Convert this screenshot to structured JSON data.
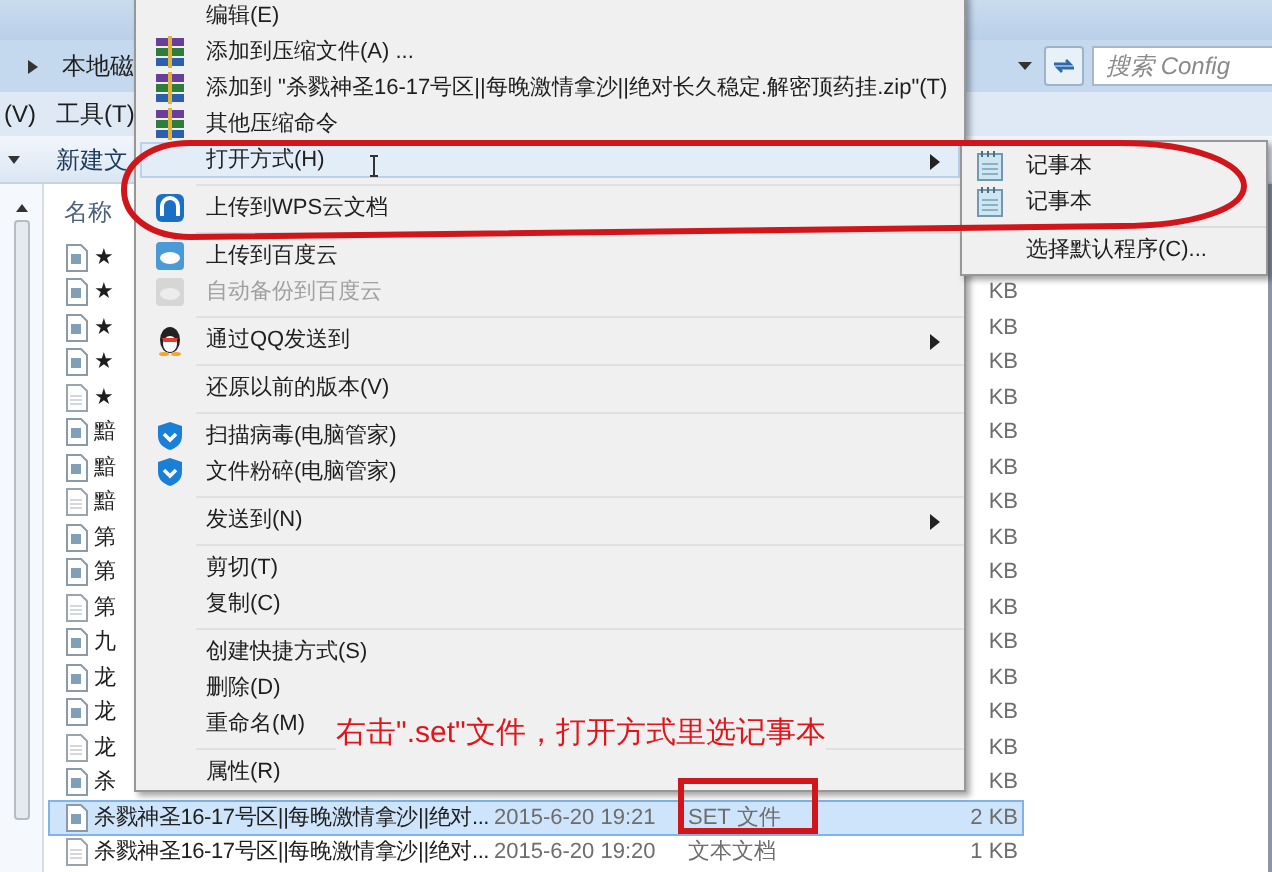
{
  "address_bar": {
    "path": "本地磁"
  },
  "search": {
    "placeholder": "搜索 Config"
  },
  "menu_bar": [
    "(V)",
    "工具(T)"
  ],
  "command_bar": [
    "新建文"
  ],
  "columns": [
    "名称"
  ],
  "files": [
    {
      "name": "★",
      "kind": "set",
      "selected": false
    },
    {
      "name": "★",
      "kind": "set",
      "size": "KB",
      "selected": false
    },
    {
      "name": "★",
      "kind": "set",
      "size": "KB",
      "selected": false
    },
    {
      "name": "★",
      "kind": "set",
      "size": "KB",
      "selected": false
    },
    {
      "name": "★",
      "kind": "text",
      "size": "KB",
      "selected": false
    },
    {
      "name": "黯",
      "kind": "set",
      "size": "KB",
      "selected": false
    },
    {
      "name": "黯",
      "kind": "set",
      "size": "KB",
      "selected": false
    },
    {
      "name": "黯",
      "kind": "text",
      "size": "KB",
      "selected": false
    },
    {
      "name": "第",
      "kind": "set",
      "size": "KB",
      "selected": false
    },
    {
      "name": "第",
      "kind": "set",
      "size": "KB",
      "selected": false
    },
    {
      "name": "第",
      "kind": "text",
      "size": "KB",
      "selected": false
    },
    {
      "name": "九",
      "kind": "set",
      "size": "KB",
      "selected": false
    },
    {
      "name": "龙",
      "kind": "set",
      "size": "KB",
      "selected": false
    },
    {
      "name": "龙",
      "kind": "set",
      "size": "KB",
      "selected": false
    },
    {
      "name": "龙",
      "kind": "text",
      "size": "KB",
      "selected": false
    },
    {
      "name": "杀",
      "kind": "set",
      "size": "KB",
      "selected": false
    },
    {
      "name": "杀戮神圣16-17号区||每晚激情拿沙||绝对...",
      "kind": "set",
      "date": "2015-6-20 19:21",
      "type": "SET 文件",
      "size": "2 KB",
      "selected": true
    },
    {
      "name": "杀戮神圣16-17号区||每晚激情拿沙||绝对...",
      "kind": "text",
      "date": "2015-6-20 19:20",
      "type": "文本文档",
      "size": "1 KB",
      "selected": false
    }
  ],
  "context_menu": {
    "groups": [
      [
        {
          "label": "编辑(E)",
          "kind": "plain",
          "selected": false,
          "disabled": false,
          "has_submenu": false
        },
        {
          "label": "添加到压缩文件(A) ...",
          "kind": "archive",
          "selected": false,
          "disabled": false,
          "has_submenu": false
        },
        {
          "label": "添加到 \"杀戮神圣16-17号区||每晚激情拿沙||绝对长久稳定.解密顶药挂.zip\"(T)",
          "kind": "archive",
          "selected": false,
          "disabled": false,
          "has_submenu": false
        },
        {
          "label": "其他压缩命令",
          "kind": "archive",
          "selected": false,
          "disabled": false,
          "has_submenu": false
        },
        {
          "label": "打开方式(H)",
          "kind": "plain",
          "selected": true,
          "disabled": false,
          "has_submenu": true
        }
      ],
      [
        {
          "label": "上传到WPS云文档",
          "kind": "wps",
          "selected": false,
          "disabled": false,
          "has_submenu": false
        }
      ],
      [
        {
          "label": "上传到百度云",
          "kind": "cloud",
          "selected": false,
          "disabled": false,
          "has_submenu": false
        },
        {
          "label": "自动备份到百度云",
          "kind": "cloud",
          "selected": false,
          "disabled": true,
          "has_submenu": false
        }
      ],
      [
        {
          "label": "通过QQ发送到",
          "kind": "penguin",
          "selected": false,
          "disabled": false,
          "has_submenu": true
        }
      ],
      [
        {
          "label": "还原以前的版本(V)",
          "kind": "plain",
          "selected": false,
          "disabled": false,
          "has_submenu": false
        }
      ],
      [
        {
          "label": "扫描病毒(电脑管家)",
          "kind": "shield",
          "selected": false,
          "disabled": false,
          "has_submenu": false
        },
        {
          "label": "文件粉碎(电脑管家)",
          "kind": "shield",
          "selected": false,
          "disabled": false,
          "has_submenu": false
        }
      ],
      [
        {
          "label": "发送到(N)",
          "kind": "plain",
          "selected": false,
          "disabled": false,
          "has_submenu": true
        }
      ],
      [
        {
          "label": "剪切(T)",
          "kind": "plain",
          "selected": false,
          "disabled": false,
          "has_submenu": false
        },
        {
          "label": "复制(C)",
          "kind": "plain",
          "selected": false,
          "disabled": false,
          "has_submenu": false
        }
      ],
      [
        {
          "label": "创建快捷方式(S)",
          "kind": "plain",
          "selected": false,
          "disabled": false,
          "has_submenu": false
        },
        {
          "label": "删除(D)",
          "kind": "plain",
          "selected": false,
          "disabled": false,
          "has_submenu": false
        },
        {
          "label": "重命名(M)",
          "kind": "plain",
          "selected": false,
          "disabled": false,
          "has_submenu": false
        }
      ],
      [
        {
          "label": "属性(R)",
          "kind": "plain",
          "selected": false,
          "disabled": false,
          "has_submenu": false
        }
      ]
    ]
  },
  "submenu": {
    "groups": [
      [
        {
          "label": "记事本",
          "kind": "notepad"
        },
        {
          "label": "记事本",
          "kind": "notepad"
        }
      ],
      [
        {
          "label": "选择默认程序(C)...",
          "kind": "plain"
        }
      ]
    ]
  },
  "annotation": {
    "text": "右击\".set\"文件，打开方式里选记事本"
  }
}
